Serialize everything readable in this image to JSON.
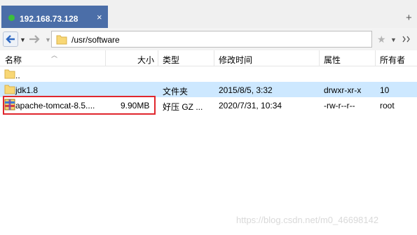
{
  "tab": {
    "title": "192.168.73.128",
    "close": "×",
    "add": "+"
  },
  "toolbar": {
    "path": "/usr/software"
  },
  "columns": [
    "名称",
    "大小",
    "类型",
    "修改时间",
    "属性",
    "所有者"
  ],
  "rows": [
    {
      "name": "..",
      "size": "",
      "type": "",
      "modified": "",
      "attrs": "",
      "owner": ""
    },
    {
      "name": "jdk1.8",
      "size": "",
      "type": "文件夹",
      "modified": "2015/8/5, 3:32",
      "attrs": "drwxr-xr-x",
      "owner": "10"
    },
    {
      "name": "apache-tomcat-8.5....",
      "size": "9.90MB",
      "type": "好压 GZ ...",
      "modified": "2020/7/31, 10:34",
      "attrs": "-rw-r--r--",
      "owner": "root"
    }
  ],
  "colors": {
    "tab_bg": "#4b6ea8",
    "selected_row": "#cde8ff",
    "highlight": "#e0262d"
  },
  "watermark": "https://blog.csdn.net/m0_46698142"
}
